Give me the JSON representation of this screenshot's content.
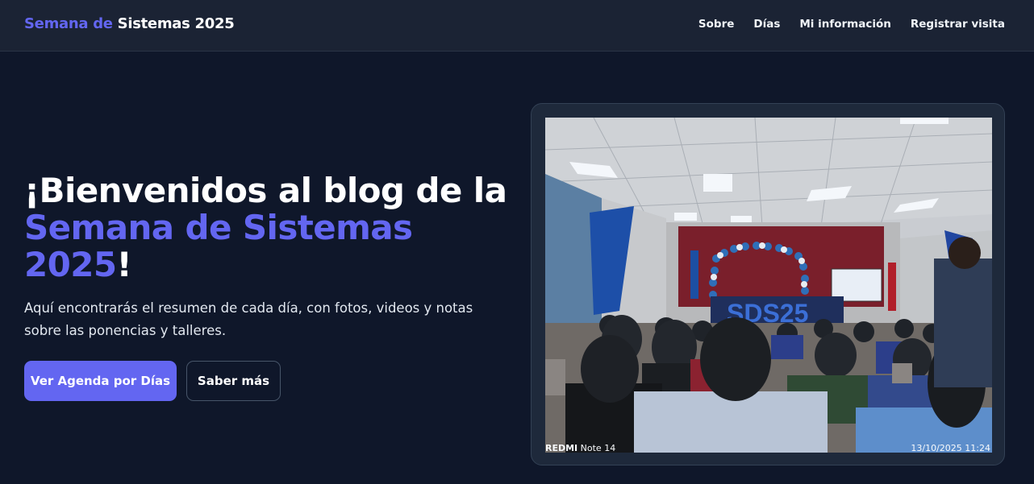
{
  "header": {
    "brand_accent": "Semana de",
    "brand_rest": "Sistemas 2025",
    "nav": [
      {
        "label": "Sobre"
      },
      {
        "label": "Días"
      },
      {
        "label": "Mi información"
      },
      {
        "label": "Registrar visita"
      }
    ]
  },
  "hero": {
    "title_prefix": "¡Bienvenidos al blog de la",
    "title_accent": "Semana de Sistemas 2025",
    "title_suffix": "!",
    "description": "Aquí encontrarás el resumen de cada día, con fotos, videos y notas sobre las ponencias y talleres.",
    "primary_button": "Ver Agenda por Días",
    "secondary_button": "Saber más"
  },
  "photo": {
    "banner_text": "SDS25",
    "watermark_brand": "REDMI",
    "watermark_model": "Note 14",
    "timestamp": "13/10/2025 11:24"
  },
  "colors": {
    "background": "#0f172a",
    "header": "#1b2334",
    "accent": "#6366f1",
    "card": "#1e293b"
  }
}
